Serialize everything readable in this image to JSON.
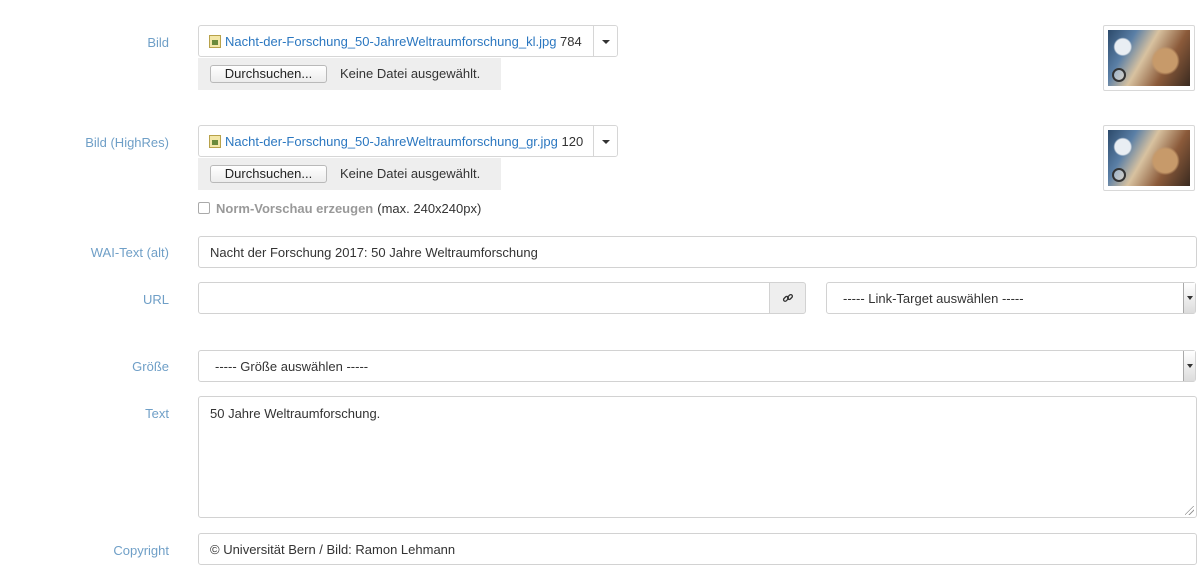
{
  "fields": {
    "bild": {
      "label": "Bild",
      "file_name": "Nacht-der-Forschung_50-JahreWeltraumforschung_kl.jpg",
      "file_size": "784",
      "browse_label": "Durchsuchen...",
      "no_file_text": "Keine Datei ausgewählt."
    },
    "bild_highres": {
      "label": "Bild (HighRes)",
      "file_name": "Nacht-der-Forschung_50-JahreWeltraumforschung_gr.jpg",
      "file_size": "120",
      "browse_label": "Durchsuchen...",
      "no_file_text": "Keine Datei ausgewählt.",
      "checkbox_label": "Norm-Vorschau erzeugen",
      "checkbox_hint": "(max. 240x240px)",
      "checkbox_checked": false
    },
    "wai_text": {
      "label": "WAI-Text (alt)",
      "value": "Nacht der Forschung 2017: 50 Jahre Weltraumforschung"
    },
    "url": {
      "label": "URL",
      "value": "",
      "link_icon": "link-icon",
      "target_select": "----- Link-Target auswählen -----"
    },
    "groesse": {
      "label": "Größe",
      "select": "----- Größe auswählen -----"
    },
    "text": {
      "label": "Text",
      "value": "50 Jahre Weltraumforschung."
    },
    "copyright": {
      "label": "Copyright",
      "value": "© Universität Bern / Bild: Ramon Lehmann"
    }
  },
  "colors": {
    "label": "#6f9fc7",
    "link": "#2b77c0",
    "border": "#d2d2d2",
    "addon_bg": "#eeeeee"
  }
}
